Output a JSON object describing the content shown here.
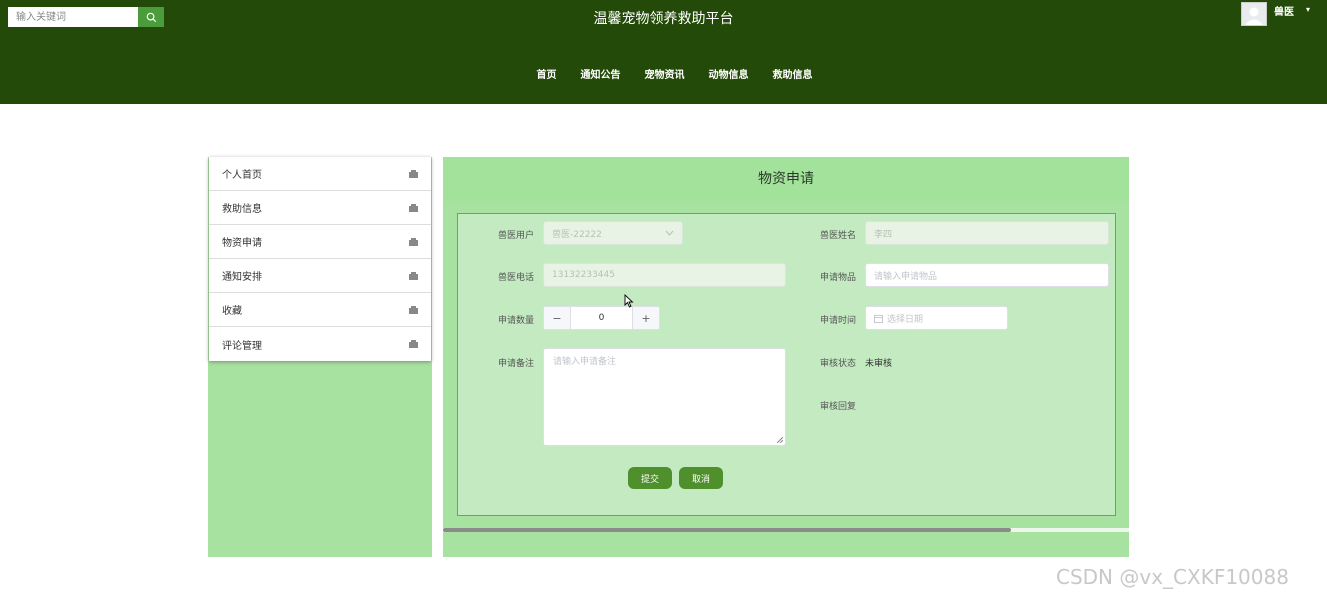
{
  "header": {
    "title": "温馨宠物领养救助平台",
    "search_placeholder": "输入关键词",
    "user_name": "兽医",
    "caret": "▾",
    "nav": [
      "首页",
      "通知公告",
      "宠物资讯",
      "动物信息",
      "救助信息"
    ],
    "bg_color": "#234a08"
  },
  "sidebar": {
    "items": [
      "个人首页",
      "救助信息",
      "物资申请",
      "通知安排",
      "收藏",
      "评论管理"
    ]
  },
  "form": {
    "title": "物资申请",
    "vet_user_label": "兽医用户",
    "vet_user_value": "兽医-22222",
    "vet_name_label": "兽医姓名",
    "vet_name_value": "李四",
    "vet_phone_label": "兽医电话",
    "vet_phone_value": "13132233445",
    "item_label": "申请物品",
    "item_placeholder": "请输入申请物品",
    "qty_label": "申请数量",
    "qty_value": "0",
    "time_label": "申请时间",
    "time_placeholder": "选择日期",
    "note_label": "申请备注",
    "note_placeholder": "请输入申请备注",
    "status_label": "审核状态",
    "status_value": "未审核",
    "reply_label": "审核回复",
    "submit": "提交",
    "cancel": "取消"
  },
  "watermark": "CSDN @vx_CXKF10088",
  "colors": {
    "panel": "#a8e2a0",
    "form": "#c3eac1",
    "button": "#4f8f2c"
  }
}
